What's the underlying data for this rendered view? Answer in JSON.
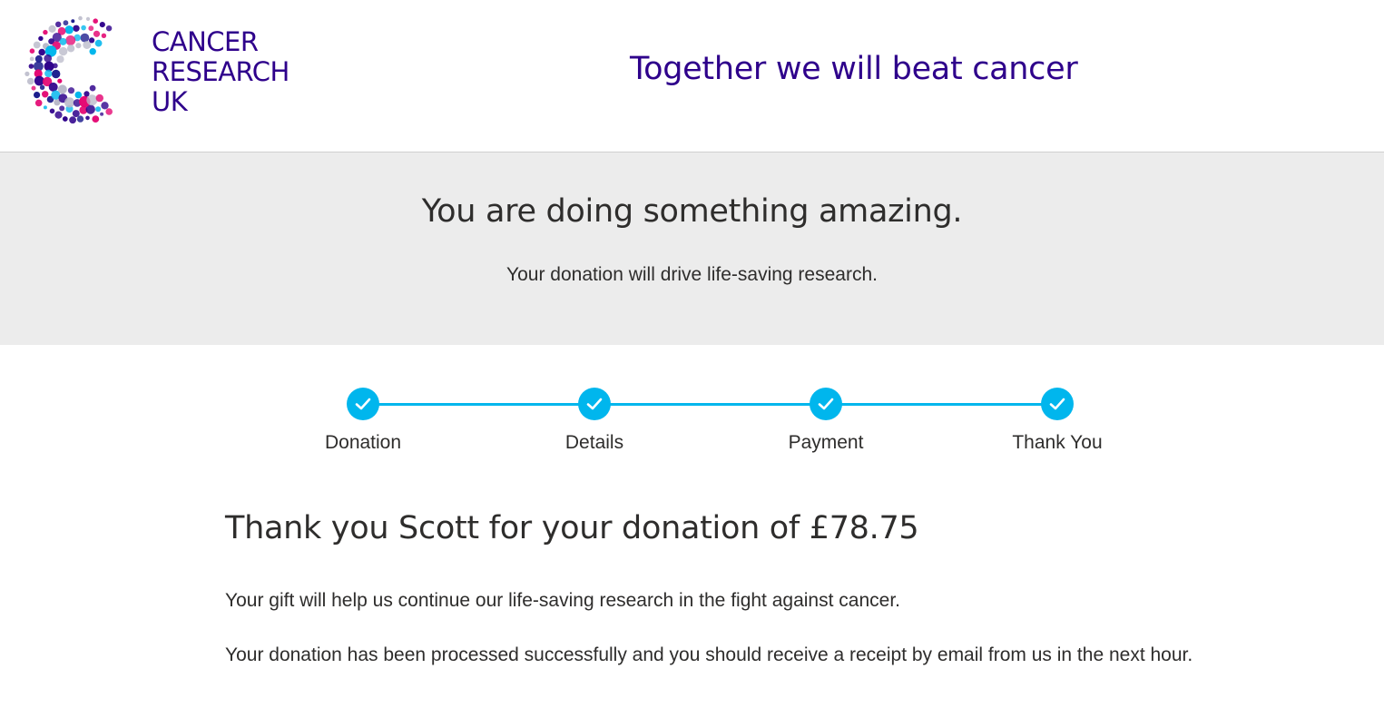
{
  "header": {
    "logo": {
      "line1": "CANCER",
      "line2": "RESEARCH",
      "line3": "UK",
      "icon": "cancer-research-uk-logo-icon"
    },
    "tagline": "Together we will beat cancer"
  },
  "hero": {
    "title": "You are doing something amazing.",
    "subtitle": "Your donation will drive life-saving research."
  },
  "progress": {
    "steps": [
      {
        "label": "Donation",
        "status": "complete",
        "icon": "check-icon"
      },
      {
        "label": "Details",
        "status": "complete",
        "icon": "check-icon"
      },
      {
        "label": "Payment",
        "status": "complete",
        "icon": "check-icon"
      },
      {
        "label": "Thank You",
        "status": "complete",
        "icon": "check-icon"
      }
    ]
  },
  "content": {
    "title": "Thank you Scott for your donation of £78.75",
    "paragraph1": "Your gift will help us continue our life-saving research in the fight against cancer.",
    "paragraph2": "Your donation has been processed successfully and you should receive a receipt by email from us in the next hour."
  },
  "colors": {
    "brand_purple": "#2e008b",
    "accent_cyan": "#00b6ed",
    "accent_pink": "#e40571",
    "hero_background": "#ececec",
    "text": "#2e2d2c"
  }
}
